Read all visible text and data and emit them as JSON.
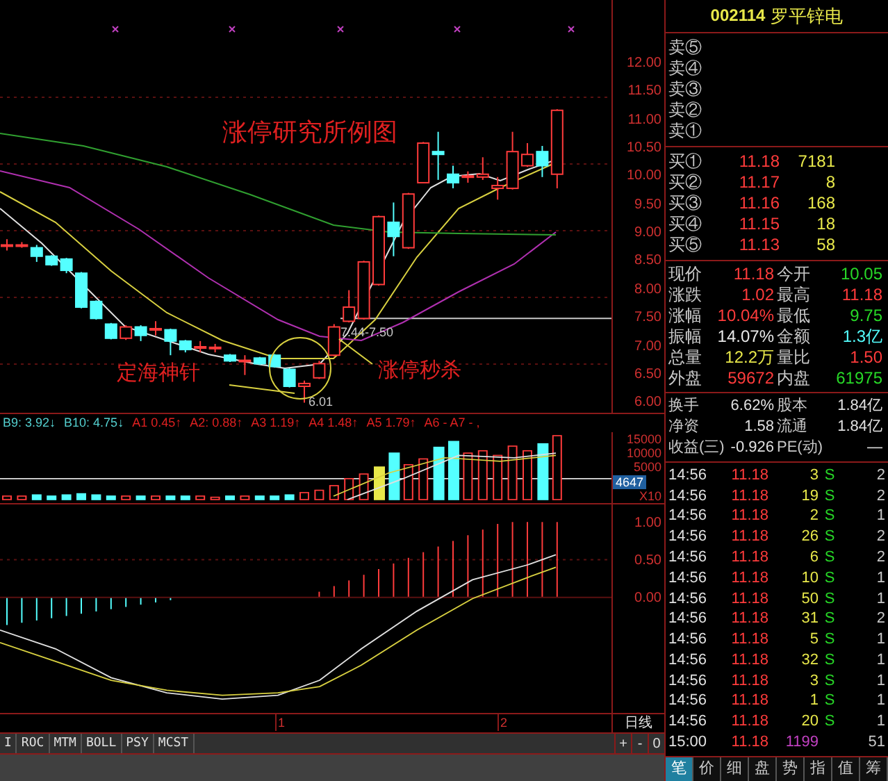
{
  "stock": {
    "code": "002114",
    "name": "罗平锌电"
  },
  "asks": [
    {
      "label": "卖⑤"
    },
    {
      "label": "卖④"
    },
    {
      "label": "卖③"
    },
    {
      "label": "卖②"
    },
    {
      "label": "卖①"
    }
  ],
  "bids": [
    {
      "label": "买①",
      "price": "11.18",
      "volume": "7181"
    },
    {
      "label": "买②",
      "price": "11.17",
      "volume": "8"
    },
    {
      "label": "买③",
      "price": "11.16",
      "volume": "168"
    },
    {
      "label": "买④",
      "price": "11.15",
      "volume": "18"
    },
    {
      "label": "买⑤",
      "price": "11.13",
      "volume": "58"
    }
  ],
  "quote": [
    [
      {
        "label": "现价",
        "value": "11.18",
        "kind": "rise"
      },
      {
        "label": "今开",
        "value": "10.05",
        "kind": "fall"
      }
    ],
    [
      {
        "label": "涨跌",
        "value": "1.02",
        "kind": "rise"
      },
      {
        "label": "最高",
        "value": "11.18",
        "kind": "rise"
      }
    ],
    [
      {
        "label": "涨幅",
        "value": "10.04%",
        "kind": "rise"
      },
      {
        "label": "最低",
        "value": "9.75",
        "kind": "fall"
      }
    ],
    [
      {
        "label": "振幅",
        "value": "14.07%",
        "kind": "flat"
      },
      {
        "label": "金额",
        "value": "1.3亿",
        "kind": "amount"
      }
    ],
    [
      {
        "label": "总量",
        "value": "12.2万",
        "kind": "volume"
      },
      {
        "label": "量比",
        "value": "1.50",
        "kind": "rise"
      }
    ],
    [
      {
        "label": "外盘",
        "value": "59672",
        "kind": "rise"
      },
      {
        "label": "内盘",
        "value": "61975",
        "kind": "fall"
      }
    ]
  ],
  "stats": [
    [
      {
        "label": "换手",
        "value": "6.62%"
      },
      {
        "label": "股本",
        "value": "1.84亿"
      }
    ],
    [
      {
        "label": "净资",
        "value": "1.58"
      },
      {
        "label": "流通",
        "value": "1.84亿"
      }
    ],
    [
      {
        "label": "收益(三)",
        "value": "-0.926"
      },
      {
        "label": "PE(动)",
        "value": "—"
      }
    ]
  ],
  "ticks": [
    {
      "time": "14:56",
      "price": "11.18",
      "volume": "3",
      "side": "S",
      "count": "2",
      "kind": "normal"
    },
    {
      "time": "14:56",
      "price": "11.18",
      "volume": "19",
      "side": "S",
      "count": "2",
      "kind": "normal"
    },
    {
      "time": "14:56",
      "price": "11.18",
      "volume": "2",
      "side": "S",
      "count": "1",
      "kind": "normal"
    },
    {
      "time": "14:56",
      "price": "11.18",
      "volume": "26",
      "side": "S",
      "count": "2",
      "kind": "normal"
    },
    {
      "time": "14:56",
      "price": "11.18",
      "volume": "6",
      "side": "S",
      "count": "2",
      "kind": "normal"
    },
    {
      "time": "14:56",
      "price": "11.18",
      "volume": "10",
      "side": "S",
      "count": "1",
      "kind": "normal"
    },
    {
      "time": "14:56",
      "price": "11.18",
      "volume": "50",
      "side": "S",
      "count": "1",
      "kind": "normal"
    },
    {
      "time": "14:56",
      "price": "11.18",
      "volume": "31",
      "side": "S",
      "count": "2",
      "kind": "normal"
    },
    {
      "time": "14:56",
      "price": "11.18",
      "volume": "5",
      "side": "S",
      "count": "1",
      "kind": "normal"
    },
    {
      "time": "14:56",
      "price": "11.18",
      "volume": "32",
      "side": "S",
      "count": "1",
      "kind": "normal"
    },
    {
      "time": "14:56",
      "price": "11.18",
      "volume": "3",
      "side": "S",
      "count": "1",
      "kind": "normal"
    },
    {
      "time": "14:56",
      "price": "11.18",
      "volume": "1",
      "side": "S",
      "count": "1",
      "kind": "normal"
    },
    {
      "time": "14:56",
      "price": "11.18",
      "volume": "20",
      "side": "S",
      "count": "1",
      "kind": "normal"
    },
    {
      "time": "15:00",
      "price": "11.18",
      "volume": "1199",
      "count": "51",
      "kind": "large"
    }
  ],
  "panel_tabs": [
    {
      "label": "笔",
      "selected": true
    },
    {
      "label": "价",
      "selected": false
    },
    {
      "label": "细",
      "selected": false
    },
    {
      "label": "盘",
      "selected": false
    },
    {
      "label": "势",
      "selected": false
    },
    {
      "label": "指",
      "selected": false
    },
    {
      "label": "值",
      "selected": false
    },
    {
      "label": "筹",
      "selected": false
    }
  ],
  "price_axis": [
    "12.00",
    "11.50",
    "11.00",
    "10.50",
    "10.00",
    "9.50",
    "9.00",
    "8.50",
    "8.00",
    "7.50",
    "7.00",
    "6.50",
    "6.00"
  ],
  "annotations": {
    "title": "涨停研究所例图",
    "left_note": "定海神针",
    "right_note": "涨停秒杀",
    "low_label": "6.01",
    "range_label": "7.44-7.50"
  },
  "indicator_values": [
    {
      "text": "B9: 3.92↓",
      "kind": "b"
    },
    {
      "text": "B10: 4.75↓",
      "kind": "b"
    },
    {
      "text": "A1 0.45↑",
      "kind": "a"
    },
    {
      "text": "A2: 0.88↑",
      "kind": "a"
    },
    {
      "text": "A3 1.19↑",
      "kind": "a"
    },
    {
      "text": "A4 1.48↑",
      "kind": "a"
    },
    {
      "text": "A5 1.79↑",
      "kind": "a"
    },
    {
      "text": "A6 - A7 - ,",
      "kind": "a"
    }
  ],
  "volume_axis": [
    "15000",
    "10000",
    "5000"
  ],
  "volume_marker": "4647",
  "volume_scale": "X10",
  "macd_axis": [
    "1.00",
    "0.50",
    "0.00"
  ],
  "x_axis": [
    "1",
    "2"
  ],
  "period": "日线",
  "indicator_tabs": [
    "I",
    "ROC",
    "MTM",
    "BOLL",
    "PSY",
    "MCST"
  ],
  "zoom_buttons": [
    "+",
    "-",
    "0"
  ]
}
